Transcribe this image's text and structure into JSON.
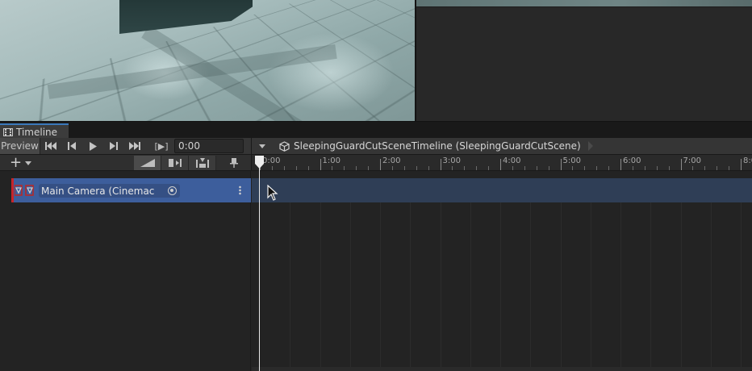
{
  "window": {
    "tab_label": "Timeline"
  },
  "toolbar": {
    "preview_label": "Preview",
    "frame_label": "[▶]",
    "current_time": "0:00",
    "breadcrumb": "SleepingGuardCutSceneTimeline (SleepingGuardCutScene)"
  },
  "track_toolbar": {
    "add_label": "+"
  },
  "ruler": {
    "labels": [
      "0:00",
      "1:00",
      "2:00",
      "3:00",
      "4:00",
      "5:00",
      "6:00",
      "7:00",
      "8:0"
    ]
  },
  "tracks": [
    {
      "label": "Main Camera (Cinemac",
      "binding_icon": "cinemachine-brain-icon",
      "color": "#3d5e9c",
      "accent": "#c8242a"
    }
  ],
  "colors": {
    "tab_accent": "#3a79bb",
    "track_selected": "#3d5e9c",
    "track_row": "#2f3e56",
    "track_accent": "#c8242a",
    "playhead": "#e8e8e8"
  }
}
